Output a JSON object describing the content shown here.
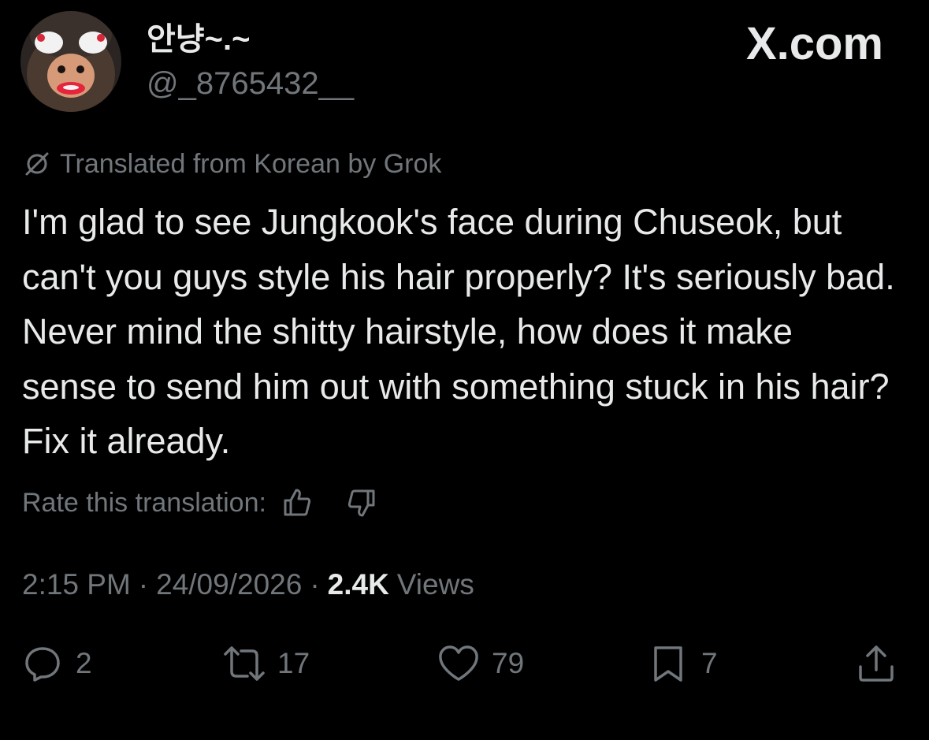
{
  "user": {
    "display_name": "안냥~.~",
    "handle": "@_8765432__"
  },
  "watermark": "X.com",
  "translation_notice": "Translated from Korean by Grok",
  "tweet": {
    "text": "I'm glad to see Jungkook's face during Chuseok, but can't you guys style his hair properly? It's seriously bad. Never mind the shitty hairstyle, how does it make sense to send him out with something stuck in his hair? Fix it already."
  },
  "rate_translation": {
    "label": "Rate this translation:",
    "icons": [
      "thumbs-up-icon",
      "thumbs-down-icon"
    ]
  },
  "meta": {
    "time": "2:15 PM",
    "date": "24/09/2026",
    "views_count": "2.4K",
    "views_label": "Views",
    "separator": "·"
  },
  "actions": {
    "replies": "2",
    "reposts": "17",
    "likes": "79",
    "bookmarks": "7"
  },
  "colors": {
    "background": "#000000",
    "primary_text": "#e7e9ea",
    "secondary_text": "#71767b"
  }
}
